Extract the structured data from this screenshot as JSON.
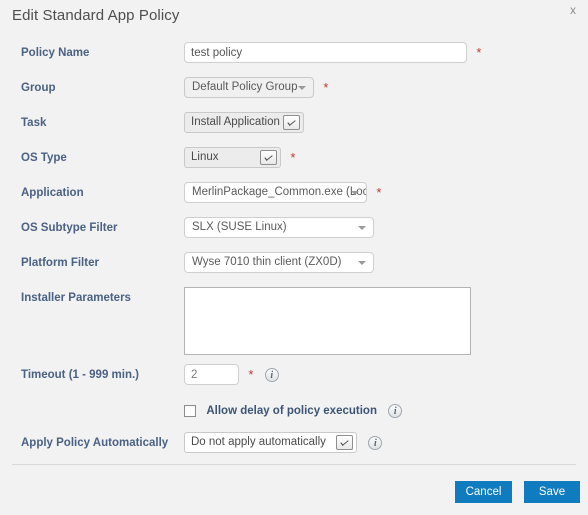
{
  "dialog": {
    "title": "Edit Standard App Policy",
    "close_label": "x"
  },
  "fields": {
    "policy_name": {
      "label": "Policy Name",
      "value": "test policy",
      "placeholder": "",
      "required_mark": "*"
    },
    "group": {
      "label": "Group",
      "value": "Default Policy Group",
      "required_mark": "*"
    },
    "task": {
      "label": "Task",
      "value": "Install Application"
    },
    "os_type": {
      "label": "OS Type",
      "value": "Linux",
      "required_mark": "*"
    },
    "application": {
      "label": "Application",
      "value": "MerlinPackage_Common.exe (Loc",
      "required_mark": "*"
    },
    "os_subtype_filter": {
      "label": "OS Subtype Filter",
      "value": "SLX (SUSE Linux)"
    },
    "platform_filter": {
      "label": "Platform Filter",
      "value": "Wyse 7010 thin client (ZX0D)"
    },
    "installer_parameters": {
      "label": "Installer Parameters",
      "value": "",
      "placeholder": ""
    },
    "timeout": {
      "label": "Timeout (1 - 999 min.)",
      "value": "2",
      "required_mark": "*",
      "info_icon": "info-icon",
      "info_glyph": "i"
    },
    "allow_delay": {
      "label": "Allow delay of policy execution",
      "checked": false,
      "info_glyph": "i"
    },
    "apply_policy_automatically": {
      "label": "Apply Policy Automatically",
      "value": "Do not apply automatically",
      "info_glyph": "i"
    }
  },
  "footer": {
    "cancel_label": "Cancel",
    "save_label": "Save"
  },
  "colors": {
    "button_blue": "#0f7cbf",
    "label_blue": "#4a6183",
    "required_red": "#c0392b",
    "dialog_background": "#f2f2f2"
  }
}
